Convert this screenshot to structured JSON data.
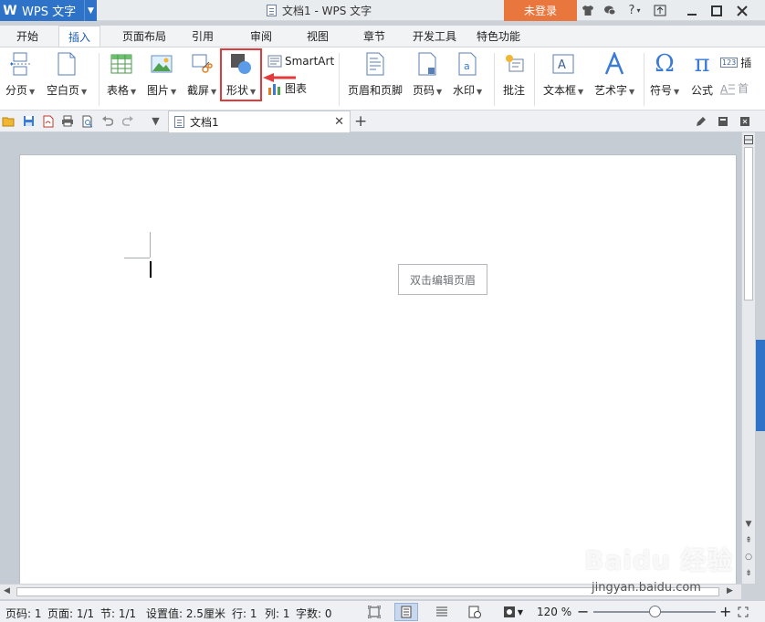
{
  "app": {
    "logo": "W",
    "name": "WPS 文字",
    "title": "文档1 - WPS 文字",
    "login": "未登录"
  },
  "tabs": [
    "开始",
    "插入",
    "页面布局",
    "引用",
    "审阅",
    "视图",
    "章节",
    "开发工具",
    "特色功能"
  ],
  "ribbon": {
    "page_break": "分页",
    "blank_page": "空白页",
    "table": "表格",
    "picture": "图片",
    "screenshot": "截屏",
    "shape": "形状",
    "smartart": "SmartArt",
    "chart": "图表",
    "header_footer": "页眉和页脚",
    "page_number": "页码",
    "watermark": "水印",
    "comment": "批注",
    "textbox": "文本框",
    "wordart": "艺术字",
    "symbol": "符号",
    "formula": "公式",
    "insert_num": "插",
    "first": "首",
    "num_badge": "123"
  },
  "document": {
    "tab_name": "文档1",
    "header_hint": "双击编辑页眉"
  },
  "status": {
    "page_code": "页码: 1",
    "pages": "页面: 1/1",
    "section": "节: 1/1",
    "setting": "设置值: 2.5厘米",
    "row": "行: 1",
    "col": "列: 1",
    "words": "字数: 0",
    "zoom": "120 %",
    "zoom_level": 0.5
  },
  "watermark_text": "Baidu 经验",
  "watermark_url": "jingyan.baidu.com",
  "colors": {
    "accent": "#2e73c7",
    "login": "#e8763d",
    "highlight": "#e23b3b"
  }
}
